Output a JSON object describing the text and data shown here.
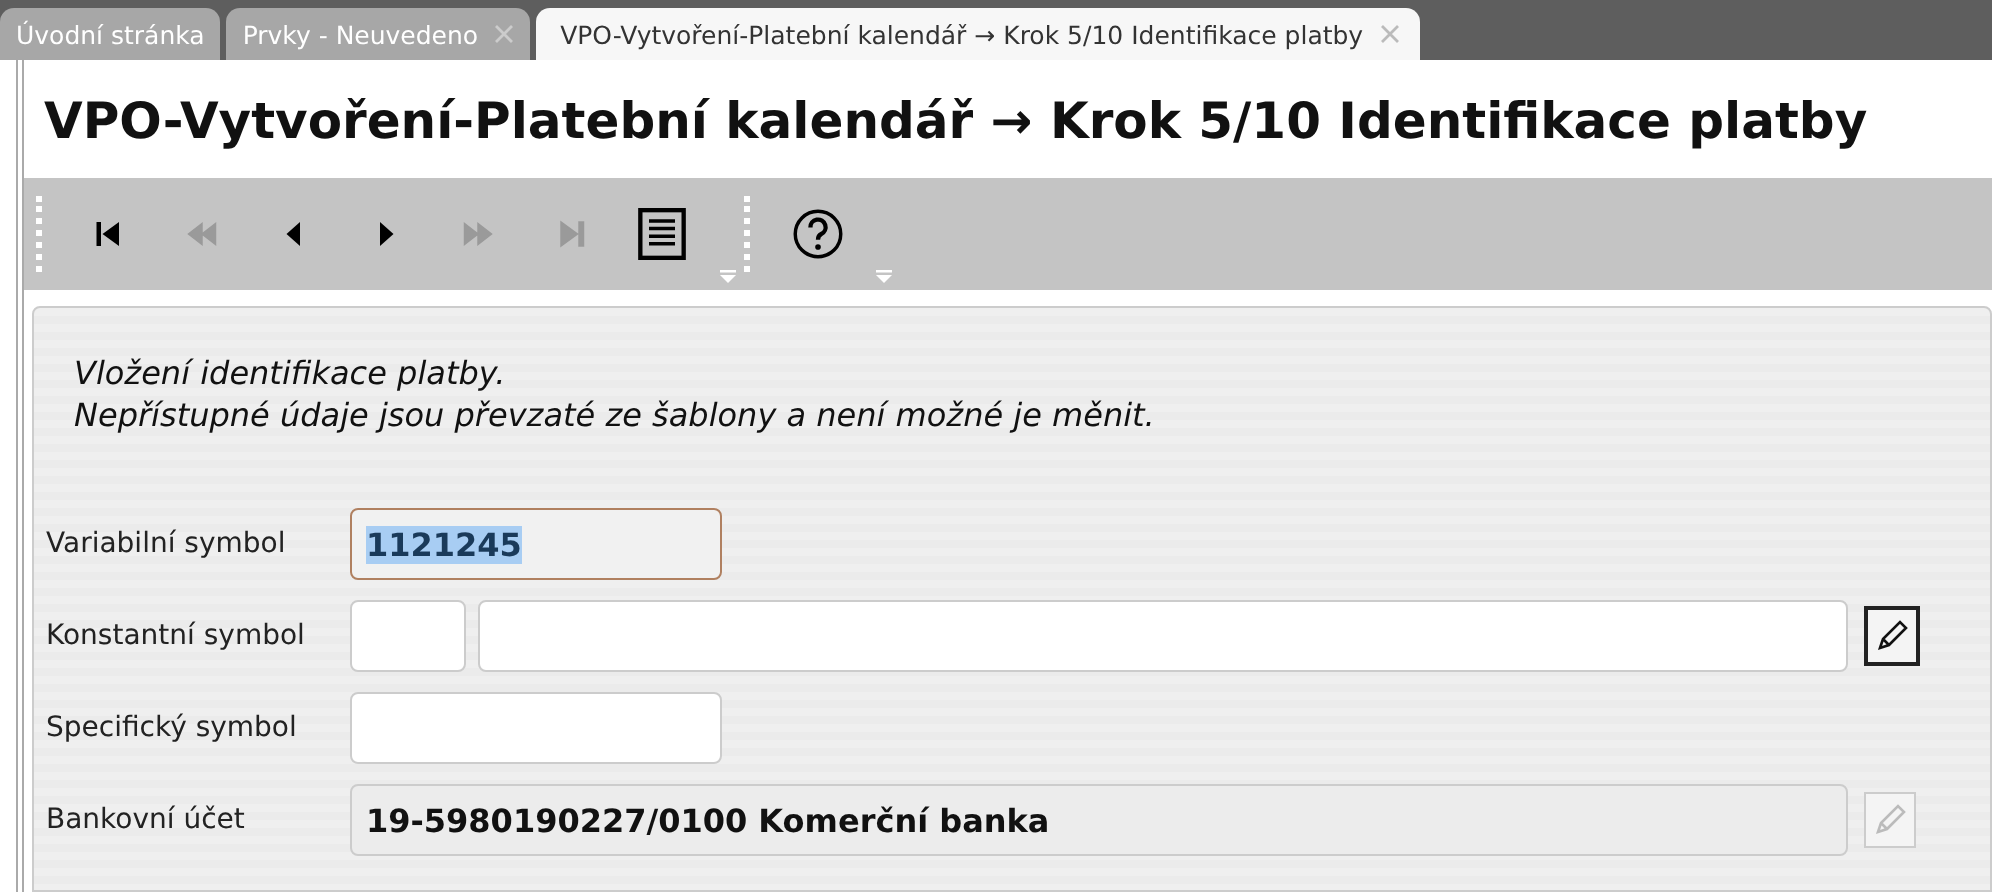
{
  "tabs": [
    {
      "label": "Úvodní stránka",
      "selected": false,
      "closable": false
    },
    {
      "label": "Prvky - Neuvedeno",
      "selected": false,
      "closable": true
    },
    {
      "label": "VPO-Vytvoření-Platební kalendář → Krok 5/10 Identifikace platby",
      "selected": true,
      "closable": true
    }
  ],
  "title": "VPO-Vytvoření-Platební kalendář → Krok 5/10 Identifikace platby",
  "toolbar": {
    "groups": [
      [
        {
          "kind": "first",
          "disabled": false
        },
        {
          "kind": "rewind",
          "disabled": true
        },
        {
          "kind": "prev",
          "disabled": false
        },
        {
          "kind": "next",
          "disabled": false
        },
        {
          "kind": "forward",
          "disabled": true
        },
        {
          "kind": "last",
          "disabled": true
        },
        {
          "kind": "list",
          "disabled": false
        }
      ],
      [
        {
          "kind": "help",
          "disabled": false
        }
      ]
    ]
  },
  "intro": [
    "Vložení identifikace platby.",
    "Nepřístupné údaje jsou převzaté ze šablony a není možné je měnit."
  ],
  "fields": [
    {
      "label": "Variabilní symbol",
      "kind": "single",
      "value": "1121245",
      "focused": true
    },
    {
      "label": "Konstantní symbol",
      "kind": "lookup",
      "disabled": false
    },
    {
      "label": "Specifický symbol",
      "kind": "single",
      "focused": false
    },
    {
      "label": "Bankovní účet",
      "kind": "readonly",
      "value": "19-5980190227/0100 Komerční banka",
      "disabled": true
    }
  ]
}
